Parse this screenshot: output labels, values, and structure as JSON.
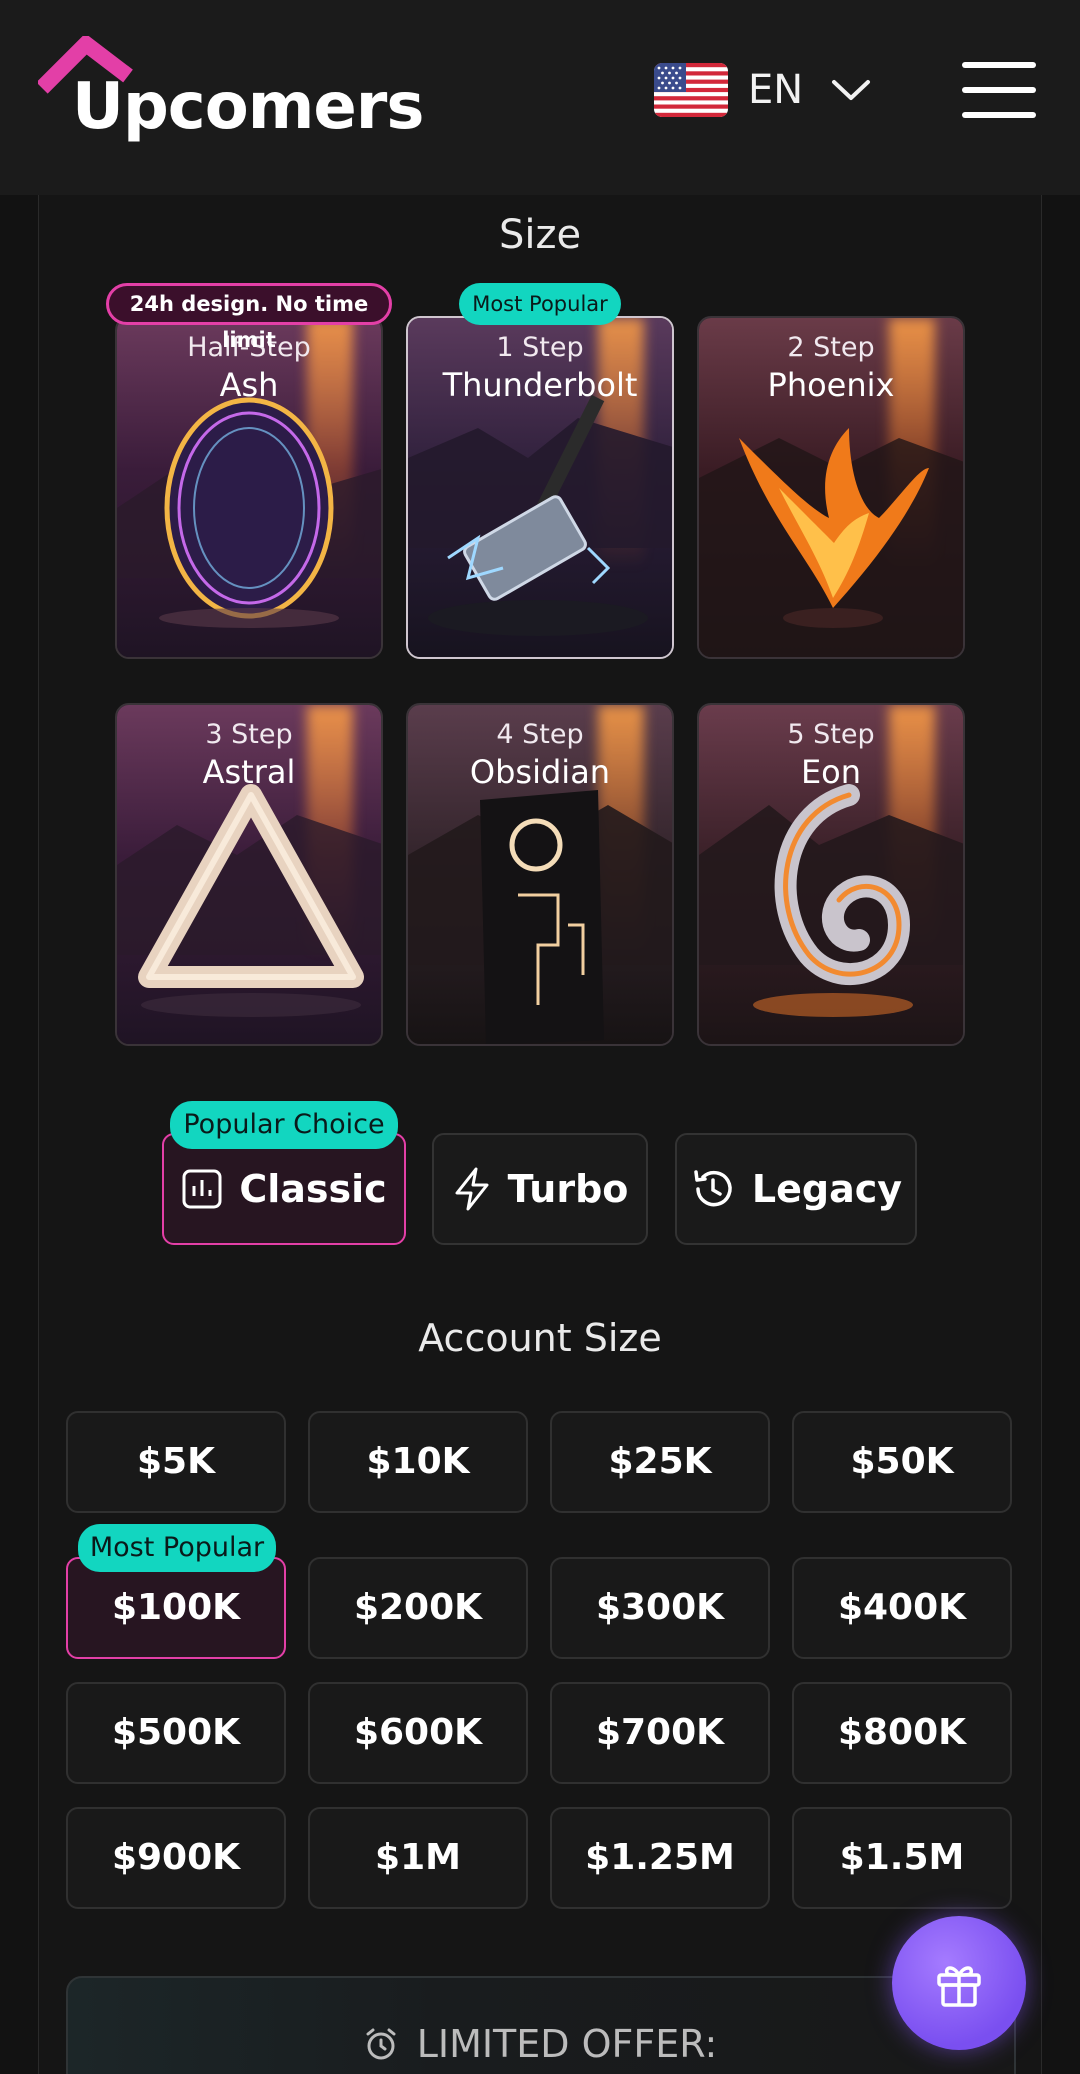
{
  "header": {
    "logo_text": "Upcomers",
    "language_code": "EN",
    "icons": {
      "logo": "house-roof-logo",
      "flag": "us-flag-icon",
      "chevron": "chevron-down-icon",
      "menu": "hamburger-menu-icon"
    }
  },
  "plans_section": {
    "heading": "Size",
    "ash_badge": "24h design. No time limit",
    "popular_badge": "Most Popular",
    "cards": [
      {
        "sub": "Half-Step",
        "name": "Ash"
      },
      {
        "sub": "1 Step",
        "name": "Thunderbolt"
      },
      {
        "sub": "2 Step",
        "name": "Phoenix"
      },
      {
        "sub": "3 Step",
        "name": "Astral"
      },
      {
        "sub": "4 Step",
        "name": "Obsidian"
      },
      {
        "sub": "5 Step",
        "name": "Eon"
      }
    ],
    "selected_card": "Thunderbolt"
  },
  "programs": {
    "badge": "Popular Choice",
    "items": [
      {
        "label": "Classic",
        "icon": "bar-chart-icon"
      },
      {
        "label": "Turbo",
        "icon": "lightning-icon"
      },
      {
        "label": "Legacy",
        "icon": "history-icon"
      }
    ],
    "selected": "Classic"
  },
  "account_size": {
    "heading": "Account Size",
    "popular_badge": "Most Popular",
    "options": [
      "$5K",
      "$10K",
      "$25K",
      "$50K",
      "$100K",
      "$200K",
      "$300K",
      "$400K",
      "$500K",
      "$600K",
      "$700K",
      "$800K",
      "$900K",
      "$1M",
      "$1.25M",
      "$1.5M"
    ],
    "selected": "$100K"
  },
  "offer": {
    "text": "LIMITED OFFER:",
    "icon": "alarm-clock-icon"
  },
  "gift_button": {
    "icon": "gift-icon"
  },
  "colors": {
    "accent_pink": "#e33fa7",
    "accent_teal": "#12d6c0",
    "background": "#121212",
    "gift_purple": "#8a5cf5"
  }
}
